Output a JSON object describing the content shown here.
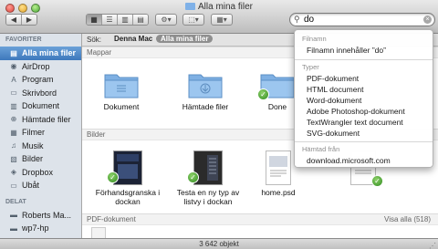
{
  "window": {
    "title": "Alla mina filer"
  },
  "toolbar": {
    "back_label": "◀",
    "forward_label": "▶",
    "action_label": "⚙▾",
    "share_label": "⬚▾",
    "arrange_label": "▦▾"
  },
  "search": {
    "query": "do",
    "icon": "magnifier-icon",
    "clear": "×"
  },
  "sidebar": {
    "favorites_header": "FAVORITER",
    "favorites": [
      {
        "label": "Alla mina filer",
        "icon": "all-files-icon",
        "glyph": "▤"
      },
      {
        "label": "AirDrop",
        "icon": "airdrop-icon",
        "glyph": "◉"
      },
      {
        "label": "Program",
        "icon": "applications-icon",
        "glyph": "A"
      },
      {
        "label": "Skrivbord",
        "icon": "desktop-icon",
        "glyph": "▭"
      },
      {
        "label": "Dokument",
        "icon": "documents-icon",
        "glyph": "▥"
      },
      {
        "label": "Hämtade filer",
        "icon": "downloads-icon",
        "glyph": "⊕"
      },
      {
        "label": "Filmer",
        "icon": "movies-icon",
        "glyph": "▦"
      },
      {
        "label": "Musik",
        "icon": "music-icon",
        "glyph": "♫"
      },
      {
        "label": "Bilder",
        "icon": "pictures-icon",
        "glyph": "▧"
      },
      {
        "label": "Dropbox",
        "icon": "dropbox-icon",
        "glyph": "◈"
      },
      {
        "label": "Ubåt",
        "icon": "folder-icon",
        "glyph": "▭"
      }
    ],
    "shared_header": "DELAT",
    "shared": [
      {
        "label": "Roberts Ma...",
        "icon": "computer-icon",
        "glyph": "▬"
      },
      {
        "label": "wp7-hp",
        "icon": "computer-icon",
        "glyph": "▬"
      }
    ]
  },
  "scope": {
    "label": "Sök:",
    "option1": "Denna Mac",
    "option2": "Alla mina filer"
  },
  "sections": {
    "folders": "Mappar",
    "pictures": "Bilder",
    "pdf": "PDF-dokument",
    "pdf_show_all": "Visa alla (518)"
  },
  "folders": [
    {
      "label": "Dokument"
    },
    {
      "label": "Hämtade filer"
    },
    {
      "label": "Done"
    }
  ],
  "pictures": [
    {
      "label": "Förhandsgranska i dockan"
    },
    {
      "label": "Testa en ny typ av listvy i dockan"
    },
    {
      "label": "home.psd"
    }
  ],
  "status": {
    "count": "3 642 objekt"
  },
  "dropdown": {
    "filename_header": "Filnamn",
    "filename_item": "Filnamn innehåller ”do”",
    "types_header": "Typer",
    "types": [
      "PDF-dokument",
      "HTML document",
      "Word-dokument",
      "Adobe Photoshop-dokument",
      "TextWrangler text document",
      "SVG-dokument"
    ],
    "source_header": "Hämtad från",
    "source_item": "download.microsoft.com"
  },
  "colors": {
    "sidebar_selection": "#4a86c8",
    "check_green": "#3c9a2a",
    "folder_blue": "#8cb9e6"
  }
}
